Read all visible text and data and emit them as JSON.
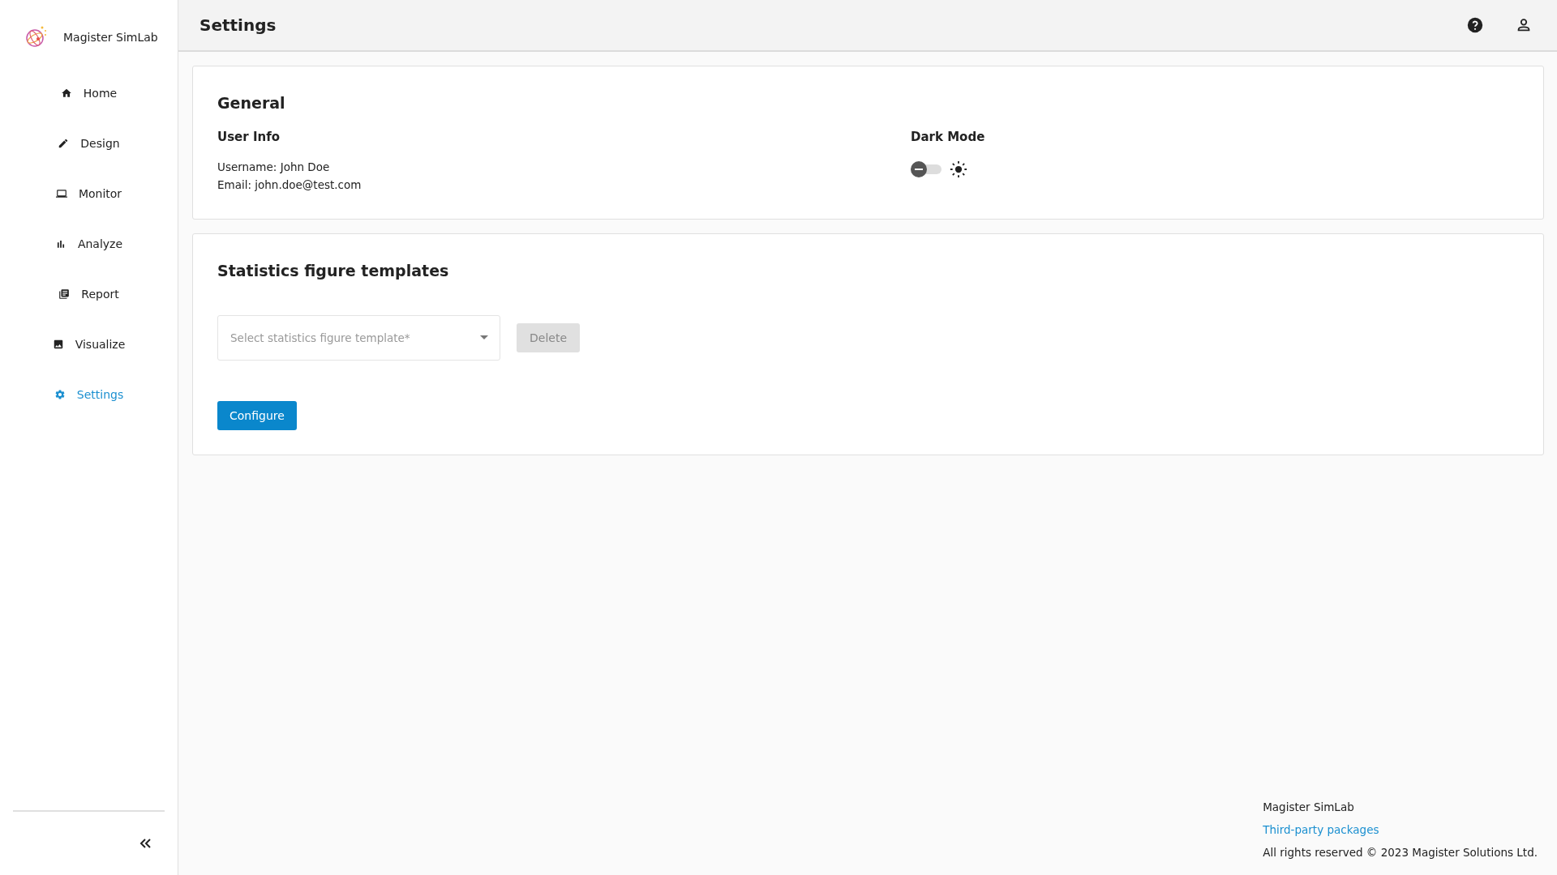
{
  "app": {
    "name": "Magister SimLab"
  },
  "sidebar": {
    "items": [
      {
        "label": "Home",
        "kind": "home",
        "selected": false
      },
      {
        "label": "Design",
        "kind": "design",
        "selected": false
      },
      {
        "label": "Monitor",
        "kind": "monitor",
        "selected": false
      },
      {
        "label": "Analyze",
        "kind": "analyze",
        "selected": false
      },
      {
        "label": "Report",
        "kind": "report",
        "selected": false
      },
      {
        "label": "Visualize",
        "kind": "visualize",
        "selected": false
      },
      {
        "label": "Settings",
        "kind": "settings",
        "selected": true
      }
    ]
  },
  "header": {
    "title": "Settings"
  },
  "general": {
    "title": "General",
    "user_info": {
      "title": "User Info",
      "lines": [
        "Username: John Doe",
        "Email: john.doe@test.com"
      ]
    },
    "dark_mode": {
      "title": "Dark Mode",
      "on": false
    }
  },
  "templates": {
    "title": "Statistics figure templates",
    "select": {
      "placeholder": "Select statistics figure template*"
    },
    "delete_button": {
      "label": "Delete",
      "disabled": true
    },
    "configure_button": {
      "label": "Configure"
    }
  },
  "footer": {
    "name": "Magister SimLab",
    "link": "Third-party packages",
    "copyright": "All rights reserved © 2023 Magister Solutions Ltd."
  }
}
